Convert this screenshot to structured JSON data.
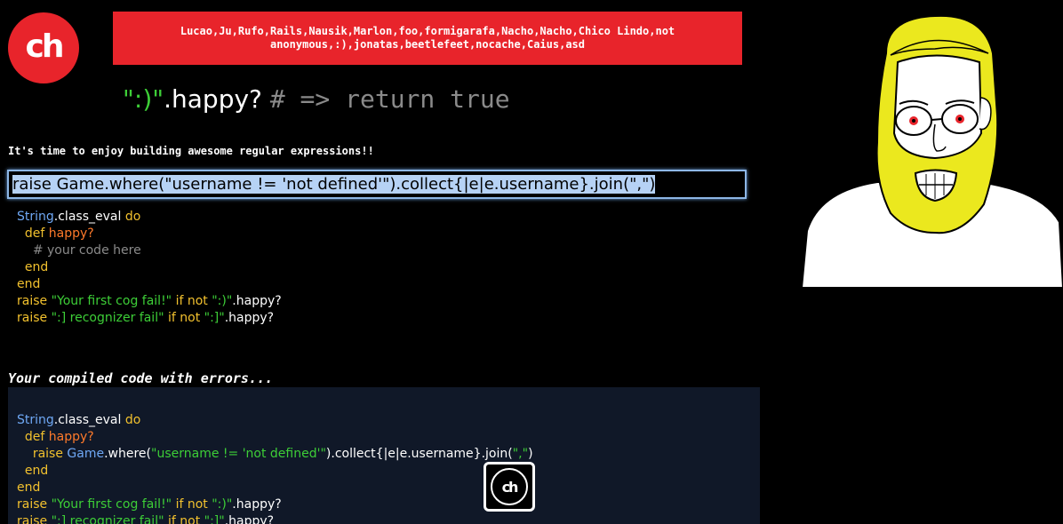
{
  "logo": {
    "text": "ch"
  },
  "banner": {
    "text": "Lucao,Ju,Rufo,Rails,Nausik,Marlon,foo,formigarafa,Nacho,Nacho,Chico Lindo,not anonymous,:),jonatas,beetlefeet,nocache,Caius,asd"
  },
  "tagline": {
    "string": "\":)\"",
    "method": ".happy?",
    "comment": "# => return true"
  },
  "intro": {
    "text": "It's time to enjoy building awesome regular expressions!!"
  },
  "answer": {
    "value": "raise Game.where(\"username != 'not defined'\").collect{|e|e.username}.join(\",\")"
  },
  "template_code": {
    "line1_const": "String",
    "line1_method": ".class_eval ",
    "line1_kw": "do",
    "line2_kw": "def ",
    "line2_name": "happy?",
    "line3_comment": "# your code here",
    "line4_kw": "end",
    "line5_kw": "end",
    "line6_kw": "raise ",
    "line6_str": "\"Your first cog fail!\"",
    "line6_kw2": " if not ",
    "line6_str2": "\":)\"",
    "line6_rest": ".happy?",
    "line7_kw": "raise ",
    "line7_str": "\":] recognizer fail\"",
    "line7_kw2": " if not ",
    "line7_str2": "\":]\"",
    "line7_rest": ".happy?"
  },
  "errors_title": {
    "text": "Your compiled code with errors..."
  },
  "compiled_code": {
    "line1_const": "String",
    "line1_method": ".class_eval ",
    "line1_kw": "do",
    "line2_kw": "def ",
    "line2_name": "happy?",
    "line3_kw": "raise ",
    "line3_const": "Game",
    "line3_method": ".where(",
    "line3_str": "\"username != 'not defined'\"",
    "line3_mid": ").collect{|e|e.username}.join(",
    "line3_str2": "\",\"",
    "line3_end": ")",
    "line4_kw": "end",
    "line5_kw": "end",
    "line6_kw": "raise ",
    "line6_str": "\"Your first cog fail!\"",
    "line6_kw2": " if not ",
    "line6_str2": "\":)\"",
    "line6_rest": ".happy?",
    "line7_kw": "raise ",
    "line7_str": "\":] recognizer fail\"",
    "line7_kw2": " if not ",
    "line7_str2": "\":]\"",
    "line7_rest": ".happy?"
  },
  "badge": {
    "text": "ch"
  },
  "colors": {
    "brand_red": "#e8242b",
    "string_green": "#3dce37",
    "keyword_yellow": "#f2c12e",
    "constant_blue": "#6fa8f5",
    "method_orange": "#ff7a2a"
  },
  "icons": {
    "logo": "ch-logo-icon",
    "badge": "ch-badge-icon",
    "portrait": "bearded-man-illustration"
  }
}
